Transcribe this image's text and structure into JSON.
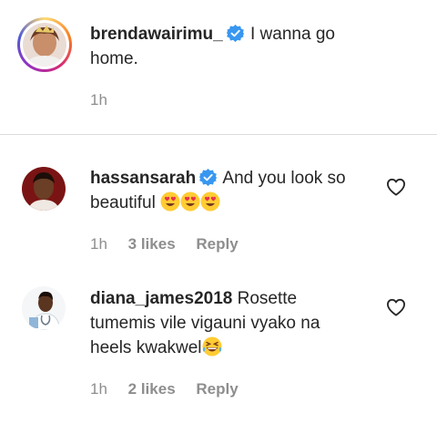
{
  "caption": {
    "username": "brendawairimu_",
    "verified": true,
    "text_line1": "I wanna go",
    "text_line2": "home.",
    "time": "1h"
  },
  "comments": [
    {
      "username": "hassansarah",
      "verified": true,
      "text_line1": "And you look so",
      "text_line2": "beautiful",
      "emojis": [
        "heart-eyes-emoji",
        "heart-eyes-emoji",
        "heart-eyes-emoji"
      ],
      "time": "1h",
      "likes": "3 likes",
      "reply": "Reply"
    },
    {
      "username": "diana_james2018",
      "verified": false,
      "text_line1": "Rosette",
      "text_line2": "tumemis vile vigauni vyako na",
      "text_line3": "heels kwakwel",
      "emojis": [
        "grinning-squinting-emoji"
      ],
      "time": "1h",
      "likes": "2 likes",
      "reply": "Reply"
    }
  ],
  "icons": {
    "verified": "verified-badge-icon",
    "like": "heart-outline-icon"
  },
  "colors": {
    "text": "#262626",
    "secondary": "#8e8e8e",
    "verified": "#3897f0",
    "divider": "#dbdbdb"
  }
}
